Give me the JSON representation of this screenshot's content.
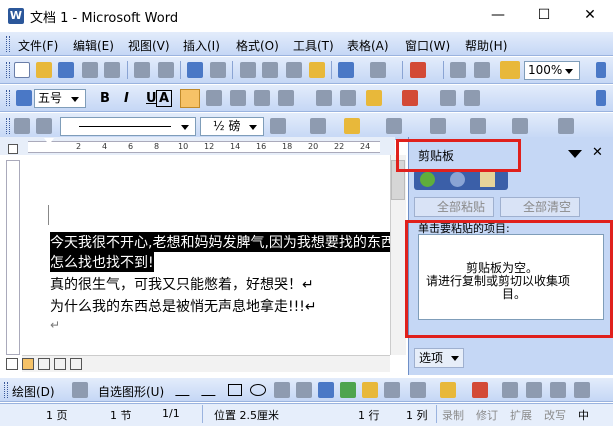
{
  "window": {
    "title": "文档 1 - Microsoft Word",
    "app_icon_letter": "W",
    "min_glyph": "—",
    "max_glyph": "☐",
    "close_glyph": "✕"
  },
  "menu": [
    "文件(F)",
    "编辑(E)",
    "视图(V)",
    "插入(I)",
    "格式(O)",
    "工具(T)",
    "表格(A)",
    "窗口(W)",
    "帮助(H)"
  ],
  "toolbar_standard": {
    "zoom": "100%"
  },
  "toolbar_format": {
    "font_size": "五号",
    "bold": "B",
    "italic": "I",
    "underline": "U",
    "char_border": "A"
  },
  "toolbar_tables": {
    "border_weight": "½ 磅"
  },
  "ruler": {
    "ticks": [
      "2",
      "4",
      "6",
      "8",
      "10",
      "12",
      "14",
      "16",
      "18",
      "20",
      "22",
      "24"
    ]
  },
  "document": {
    "lines": [
      {
        "text": "今天我很不开心,老想和妈妈发脾气,因为我想要找的东西,",
        "selected": true
      },
      {
        "text": "怎么找也找不到!",
        "selected": true
      },
      {
        "text": "真的很生气，可我又只能憋着，好想哭！↵",
        "selected": false
      },
      {
        "text": "为什么我的东西总是被悄无声息地拿走!!!↵",
        "selected": false
      },
      {
        "text": "↵",
        "selected": false
      }
    ]
  },
  "task_pane": {
    "title": "剪贴板",
    "paste_all": "全部粘贴",
    "clear_all": "全部清空",
    "instruction": "单击要粘贴的项目:",
    "empty_line1": "剪贴板为空。",
    "empty_line2": "请进行复制或剪切以收集项",
    "empty_line3": "目。",
    "options": "选项"
  },
  "drawing": {
    "draw_label": "绘图(D)",
    "autoshapes_label": "自选图形(U)"
  },
  "status": {
    "page": "1 页",
    "section": "1 节",
    "pages": "1/1",
    "position": "位置 2.5厘米",
    "line": "1 行",
    "col": "1 列",
    "rec": "录制",
    "trk": "修订",
    "ext": "扩展",
    "ovr": "改写",
    "lang": "中"
  }
}
